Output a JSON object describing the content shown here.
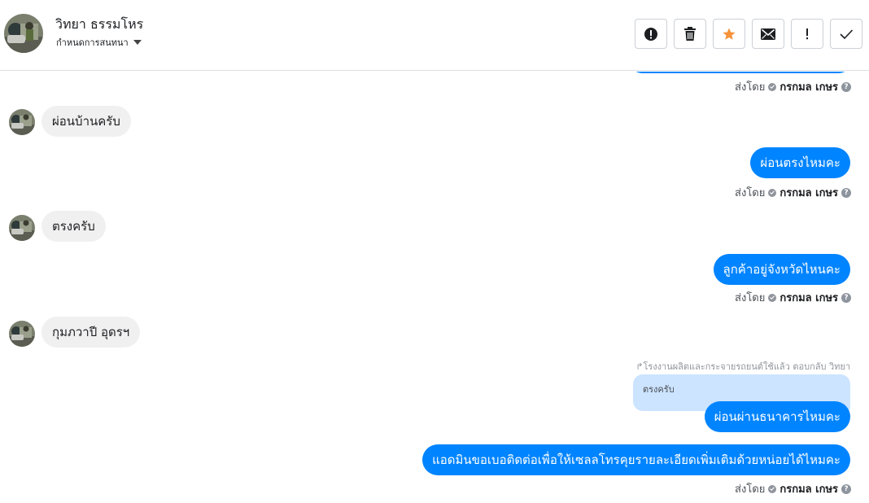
{
  "header": {
    "contact_name": "วิทยา ธรรมโหร",
    "subtitle": "กำหนดการสนทนา",
    "actions": [
      {
        "name": "spam-button",
        "icon": "exclamation-circle-icon"
      },
      {
        "name": "delete-button",
        "icon": "trash-icon"
      },
      {
        "name": "star-button",
        "icon": "star-icon",
        "color": "#f7923b"
      },
      {
        "name": "mark-unread-button",
        "icon": "envelope-icon"
      },
      {
        "name": "follow-up-button",
        "icon": "exclamation-icon"
      },
      {
        "name": "mark-done-button",
        "icon": "checkmark-icon"
      }
    ]
  },
  "colors": {
    "outgoing_bubble": "#0084ff",
    "incoming_bubble": "#f1f0f0",
    "quoted_bubble": "#cce4ff"
  },
  "sent_by": {
    "prefix": "ส่งโดย",
    "name": "กรกมล เกษร"
  },
  "messages": [
    {
      "direction": "in",
      "text": "ผ่อนบ้านครับ"
    },
    {
      "direction": "out",
      "text": "ผ่อนตรงไหมคะ"
    },
    {
      "direction": "in",
      "text": "ตรงครับ"
    },
    {
      "direction": "out",
      "text": "ลูกค้าอยู่จังหวัดไหนคะ"
    },
    {
      "direction": "in",
      "text": "กุมภวาปี อุดรฯ"
    },
    {
      "direction": "out",
      "text": "ผ่อนผ่านธนาคารไหมคะ"
    },
    {
      "direction": "out",
      "text": "แอดมินขอเบอติดต่อเพื่อให้เซลลโทรคุยรายละเอียดเพิ่มเติมด้วยหน่อยได้ไหมคะ"
    }
  ],
  "reply": {
    "note": "โรงงานผลิตและกระจายรถยนต์ใช้แล้ว ตอบกลับ วิทยา",
    "quoted_text": "ตรงครับ"
  }
}
